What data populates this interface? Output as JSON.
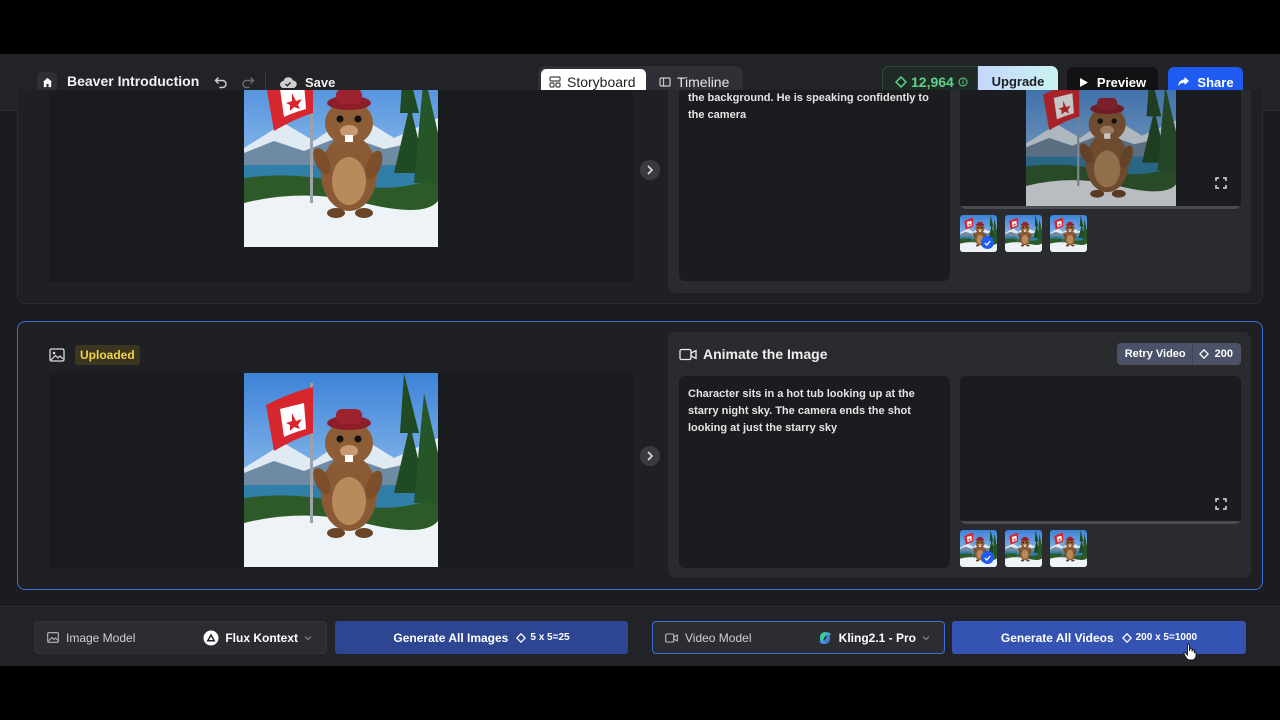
{
  "header": {
    "project_title": "Beaver Introduction",
    "save_label": "Save",
    "tabs": [
      {
        "label": "Storyboard",
        "active": true
      },
      {
        "label": "Timeline",
        "active": false
      }
    ],
    "credits": "12,964",
    "upgrade_label": "Upgrade",
    "preview_label": "Preview",
    "share_label": "Share"
  },
  "scenes": [
    {
      "prompt": "the background. He is speaking confidently to the camera",
      "thumbnails": 3,
      "selected_thumbnail": 0
    },
    {
      "badge": "Uploaded",
      "panel_title": "Animate the Image",
      "retry_label": "Retry Video",
      "retry_cost": "200",
      "prompt": "Character sits in a hot tub looking up at the starry night sky. The camera ends the shot looking at just the starry sky",
      "thumbnails": 3,
      "selected_thumbnail": 0
    }
  ],
  "bottom": {
    "image_model_label": "Image Model",
    "image_model_value": "Flux Kontext",
    "generate_images_label": "Generate All Images",
    "generate_images_cost": "5 x 5=25",
    "video_model_label": "Video Model",
    "video_model_value": "Kling2.1 - Pro",
    "generate_videos_label": "Generate All Videos",
    "generate_videos_cost": "200 x 5=1000"
  },
  "colors": {
    "accent_blue": "#1f5bf2",
    "credits_green": "#5fd38a",
    "uploaded_yellow": "#f1d44a",
    "generate_button": "#2e4592"
  }
}
